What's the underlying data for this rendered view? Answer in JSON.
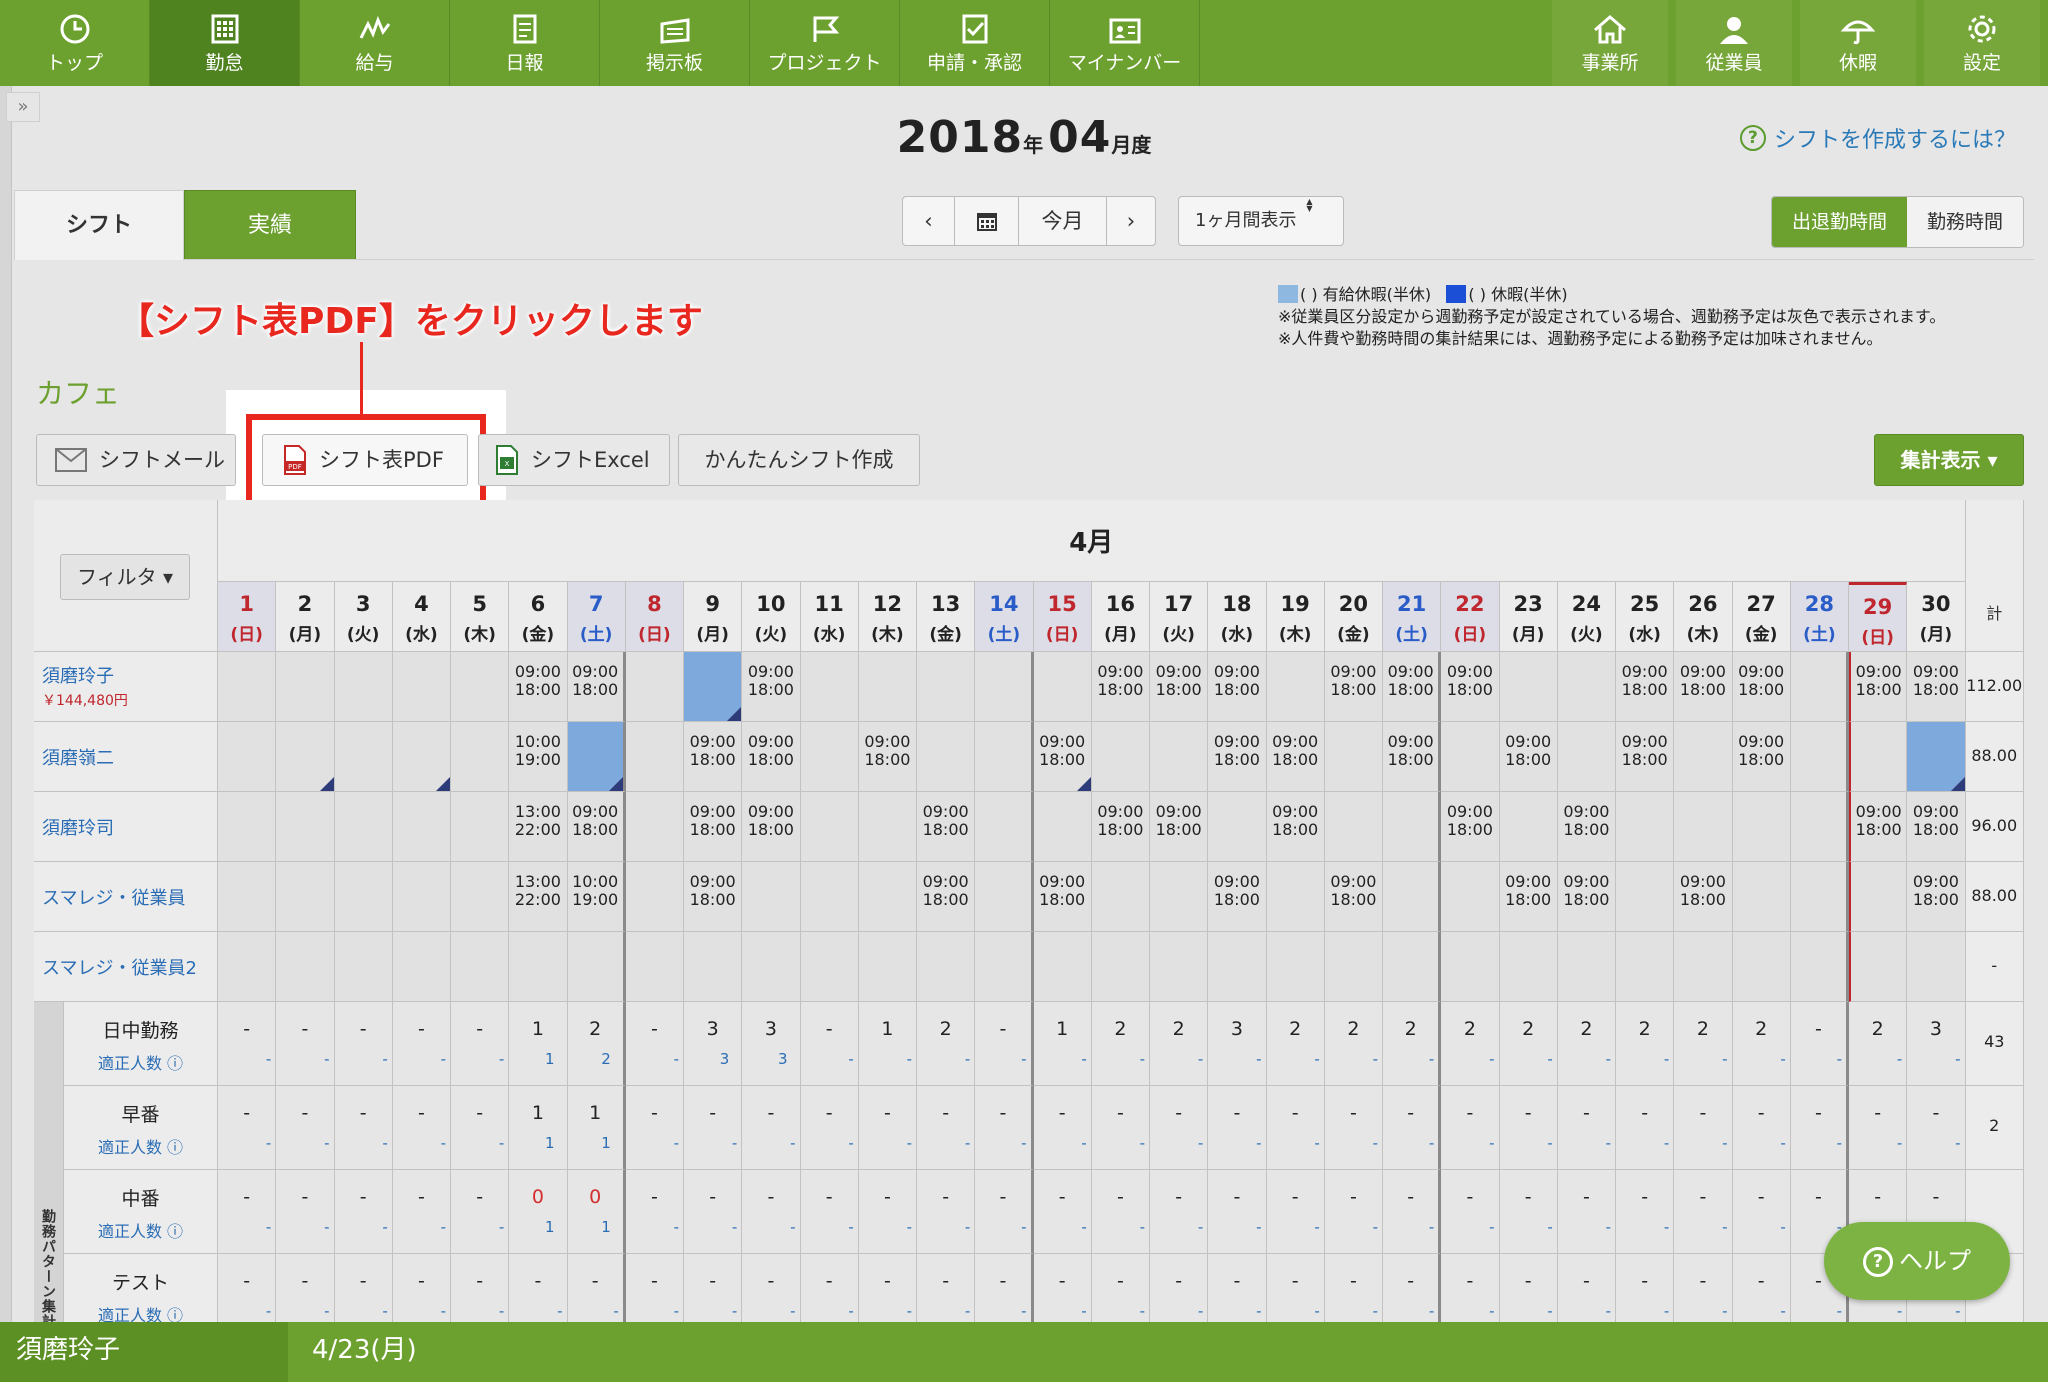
{
  "nav": {
    "left": [
      {
        "key": "top",
        "label": "トップ",
        "icon": "clock-icon"
      },
      {
        "key": "kintai",
        "label": "勤怠",
        "icon": "calendar-grid-icon"
      },
      {
        "key": "kyuyo",
        "label": "給与",
        "icon": "wave-icon"
      },
      {
        "key": "nippo",
        "label": "日報",
        "icon": "document-icon"
      },
      {
        "key": "keijiban",
        "label": "掲示板",
        "icon": "board-icon"
      },
      {
        "key": "project",
        "label": "プロジェクト",
        "icon": "flag-icon"
      },
      {
        "key": "shinsei",
        "label": "申請・承認",
        "icon": "checklist-icon"
      },
      {
        "key": "mynumber",
        "label": "マイナンバー",
        "icon": "id-card-icon"
      }
    ],
    "right": [
      {
        "key": "jigyosho",
        "label": "事業所",
        "icon": "home-icon"
      },
      {
        "key": "jugyoin",
        "label": "従業員",
        "icon": "person-icon"
      },
      {
        "key": "kyuka",
        "label": "休暇",
        "icon": "umbrella-icon"
      },
      {
        "key": "settei",
        "label": "設定",
        "icon": "gear-icon"
      }
    ]
  },
  "header": {
    "year": "2018",
    "year_suffix": "年",
    "month": "04",
    "month_suffix": "月度",
    "help_link": "シフトを作成するには？"
  },
  "tabs": {
    "shift": "シフト",
    "actual": "実績"
  },
  "controls": {
    "prev": "‹",
    "next": "›",
    "today": "今月",
    "period": "1ヶ月間表示",
    "toggle_on": "出退勤時間",
    "toggle_off": "勤務時間"
  },
  "legend": {
    "paid": "(  ) 有給休暇(半休)",
    "leave": "(  ) 休暇(半休)",
    "note1": "※従業員区分設定から週勤務予定が設定されている場合、週勤務予定は灰色で表示されます。",
    "note2": "※人件費や勤務時間の集計結果には、週勤務予定による勤務予定は加味されません。",
    "paid_color": "#8fb8e0",
    "leave_color": "#1a4fd6"
  },
  "annotation": "【シフト表PDF】をクリックします",
  "store": "カフェ",
  "buttons": {
    "mail": "シフトメール",
    "pdf": "シフト表PDF",
    "excel": "シフトExcel",
    "easy": "かんたんシフト作成",
    "aggregate": "集計表示 ▾"
  },
  "table": {
    "filter": "フィルタ ▾",
    "month_label": "4月",
    "total_label": "計",
    "days": [
      {
        "d": "1",
        "w": "(日)",
        "t": "sun"
      },
      {
        "d": "2",
        "w": "(月)",
        "t": "wd"
      },
      {
        "d": "3",
        "w": "(火)",
        "t": "wd"
      },
      {
        "d": "4",
        "w": "(水)",
        "t": "wd"
      },
      {
        "d": "5",
        "w": "(木)",
        "t": "wd"
      },
      {
        "d": "6",
        "w": "(金)",
        "t": "wd"
      },
      {
        "d": "7",
        "w": "(土)",
        "t": "sat"
      },
      {
        "d": "8",
        "w": "(日)",
        "t": "sun"
      },
      {
        "d": "9",
        "w": "(月)",
        "t": "wd"
      },
      {
        "d": "10",
        "w": "(火)",
        "t": "wd"
      },
      {
        "d": "11",
        "w": "(水)",
        "t": "wd"
      },
      {
        "d": "12",
        "w": "(木)",
        "t": "wd"
      },
      {
        "d": "13",
        "w": "(金)",
        "t": "wd"
      },
      {
        "d": "14",
        "w": "(土)",
        "t": "sat"
      },
      {
        "d": "15",
        "w": "(日)",
        "t": "sun"
      },
      {
        "d": "16",
        "w": "(月)",
        "t": "wd"
      },
      {
        "d": "17",
        "w": "(火)",
        "t": "wd"
      },
      {
        "d": "18",
        "w": "(水)",
        "t": "wd"
      },
      {
        "d": "19",
        "w": "(木)",
        "t": "wd"
      },
      {
        "d": "20",
        "w": "(金)",
        "t": "wd"
      },
      {
        "d": "21",
        "w": "(土)",
        "t": "sat"
      },
      {
        "d": "22",
        "w": "(日)",
        "t": "sun"
      },
      {
        "d": "23",
        "w": "(月)",
        "t": "wd"
      },
      {
        "d": "24",
        "w": "(火)",
        "t": "wd"
      },
      {
        "d": "25",
        "w": "(水)",
        "t": "wd"
      },
      {
        "d": "26",
        "w": "(木)",
        "t": "wd"
      },
      {
        "d": "27",
        "w": "(金)",
        "t": "wd"
      },
      {
        "d": "28",
        "w": "(土)",
        "t": "sat"
      },
      {
        "d": "29",
        "w": "(日)",
        "t": "sun"
      },
      {
        "d": "30",
        "w": "(月)",
        "t": "wd"
      }
    ],
    "employees": [
      {
        "name": "須磨玲子",
        "sub": "￥144,480円",
        "total": "112.00",
        "cells": {
          "6": "09:00|18:00",
          "7": "09:00|18:00",
          "9": "#L",
          "10": "09:00|18:00",
          "16": "09:00|18:00",
          "17": "09:00|18:00",
          "18": "09:00|18:00",
          "20": "09:00|18:00",
          "21": "09:00|18:00",
          "22": "09:00|18:00",
          "25": "09:00|18:00",
          "26": "09:00|18:00",
          "27": "09:00|18:00",
          "29": "09:00|18:00",
          "30": "09:00|18:00"
        },
        "half": [
          "9"
        ]
      },
      {
        "name": "須磨嶺二",
        "sub": "",
        "total": "88.00",
        "cells": {
          "6": "10:00|19:00",
          "7": "#L",
          "9": "09:00|18:00",
          "10": "09:00|18:00",
          "12": "09:00|18:00",
          "15": "09:00|18:00",
          "18": "09:00|18:00",
          "19": "09:00|18:00",
          "21": "09:00|18:00",
          "23": "09:00|18:00",
          "25": "09:00|18:00",
          "27": "09:00|18:00",
          "30": "#L"
        },
        "half": [
          "2",
          "4",
          "7",
          "15",
          "30"
        ]
      },
      {
        "name": "須磨玲司",
        "sub": "",
        "total": "96.00",
        "cells": {
          "6": "13:00|22:00",
          "7": "09:00|18:00",
          "9": "09:00|18:00",
          "10": "09:00|18:00",
          "13": "09:00|18:00",
          "16": "09:00|18:00",
          "17": "09:00|18:00",
          "19": "09:00|18:00",
          "22": "09:00|18:00",
          "24": "09:00|18:00",
          "29": "09:00|18:00",
          "30": "09:00|18:00"
        },
        "half": []
      },
      {
        "name": "スマレジ・従業員",
        "sub": "",
        "total": "88.00",
        "cells": {
          "6": "13:00|22:00",
          "7": "10:00|19:00",
          "9": "09:00|18:00",
          "13": "09:00|18:00",
          "15": "09:00|18:00",
          "18": "09:00|18:00",
          "20": "09:00|18:00",
          "23": "09:00|18:00",
          "24": "09:00|18:00",
          "26": "09:00|18:00",
          "30": "09:00|18:00"
        },
        "half": []
      },
      {
        "name": "スマレジ・従業員2",
        "sub": "",
        "total": "-",
        "cells": {},
        "half": []
      }
    ],
    "pattern_label": "勤務パターン集計",
    "patterns": [
      {
        "name": "日中勤務",
        "sub": "適正人数",
        "total": "43",
        "top": [
          "-",
          "-",
          "-",
          "-",
          "-",
          "1",
          "2",
          "-",
          "3",
          "3",
          "-",
          "1",
          "2",
          "-",
          "1",
          "2",
          "2",
          "3",
          "2",
          "2",
          "2",
          "2",
          "2",
          "2",
          "2",
          "2",
          "2",
          "-",
          "2",
          "3"
        ],
        "bot": {
          "6": "1",
          "7": "2",
          "9": "3",
          "10": "3"
        }
      },
      {
        "name": "早番",
        "sub": "適正人数",
        "total": "2",
        "top": [
          "-",
          "-",
          "-",
          "-",
          "-",
          "1",
          "1",
          "-",
          "-",
          "-",
          "-",
          "-",
          "-",
          "-",
          "-",
          "-",
          "-",
          "-",
          "-",
          "-",
          "-",
          "-",
          "-",
          "-",
          "-",
          "-",
          "-",
          "-",
          "-",
          "-"
        ],
        "bot": {
          "6": "1",
          "7": "1"
        }
      },
      {
        "name": "中番",
        "sub": "適正人数",
        "total": "",
        "top": [
          "-",
          "-",
          "-",
          "-",
          "-",
          "0",
          "0",
          "-",
          "-",
          "-",
          "-",
          "-",
          "-",
          "-",
          "-",
          "-",
          "-",
          "-",
          "-",
          "-",
          "-",
          "-",
          "-",
          "-",
          "-",
          "-",
          "-",
          "-",
          "-",
          "-"
        ],
        "bot": {
          "6": "1",
          "7": "1"
        },
        "red": [
          "6",
          "7"
        ]
      },
      {
        "name": "テスト",
        "sub": "適正人数",
        "total": "",
        "top": [
          "-",
          "-",
          "-",
          "-",
          "-",
          "-",
          "-",
          "-",
          "-",
          "-",
          "-",
          "-",
          "-",
          "-",
          "-",
          "-",
          "-",
          "-",
          "-",
          "-",
          "-",
          "-",
          "-",
          "-",
          "-",
          "-",
          "-",
          "-",
          "-",
          "-"
        ],
        "bot": {}
      }
    ]
  },
  "help_button": "ヘルプ",
  "footer": {
    "name": "須磨玲子",
    "date": "4/23(月)"
  }
}
